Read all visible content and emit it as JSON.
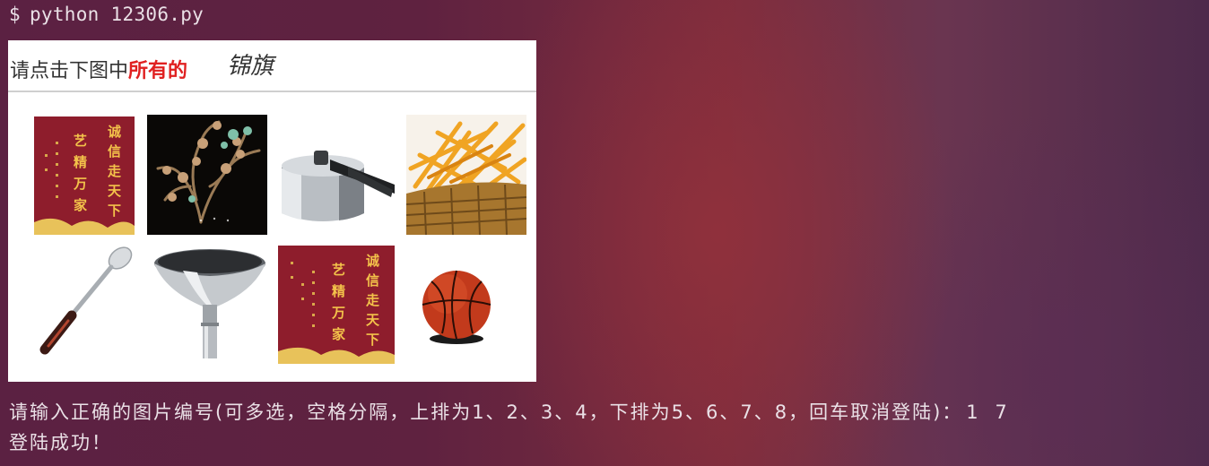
{
  "terminal": {
    "prompt": "$",
    "command": "python 12306.py",
    "input_prompt": "请输入正确的图片编号(可多选，空格分隔，上排为1、2、3、4，下排为5、6、7、8，回车取消登陆)：",
    "user_input": "1 7",
    "result": "登陆成功！"
  },
  "captcha": {
    "instruction_prefix": "请点击下图中",
    "instruction_highlight": "所有的",
    "target_word": "锦旗",
    "images": [
      {
        "index": 1,
        "subject": "pennant"
      },
      {
        "index": 2,
        "subject": "coral-plant"
      },
      {
        "index": 3,
        "subject": "pressure-cooker"
      },
      {
        "index": 4,
        "subject": "fries-basket"
      },
      {
        "index": 5,
        "subject": "spoon"
      },
      {
        "index": 6,
        "subject": "funnel"
      },
      {
        "index": 7,
        "subject": "pennant"
      },
      {
        "index": 8,
        "subject": "basketball"
      }
    ],
    "pennant_text": [
      "诚",
      "信",
      "走",
      "天",
      "下",
      "艺",
      "精",
      "万",
      "家"
    ]
  },
  "colors": {
    "instruction_highlight": "#e02020",
    "terminal_text": "#eae0e6"
  }
}
